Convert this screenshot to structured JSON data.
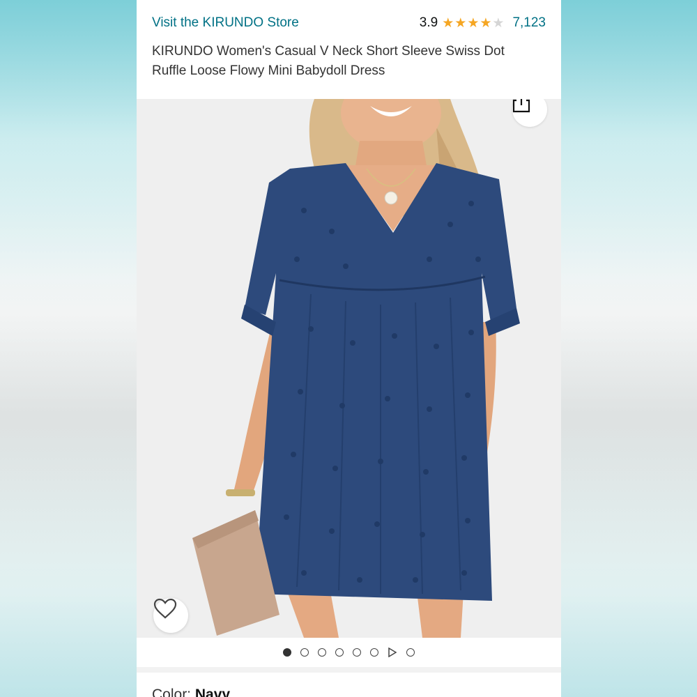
{
  "header": {
    "store_link": "Visit the KIRUNDO Store",
    "rating_value": "3.9",
    "rating_stars": 3.9,
    "review_count": "7,123",
    "title": "KIRUNDO Women's Casual V Neck Short Sleeve Swiss Dot Ruffle Loose Flowy Mini Babydoll Dress"
  },
  "gallery": {
    "image_alt": "Model wearing navy swiss dot babydoll dress holding a beige clutch",
    "share_icon": "share-icon",
    "favorite_icon": "heart-icon",
    "active_index": 0,
    "total_items": 8,
    "video_index": 6
  },
  "variant": {
    "color_label": "Color: ",
    "color_value": "Navy"
  },
  "colors": {
    "link": "#007185",
    "star": "#f5a623",
    "dress": "#2d4a7c"
  }
}
